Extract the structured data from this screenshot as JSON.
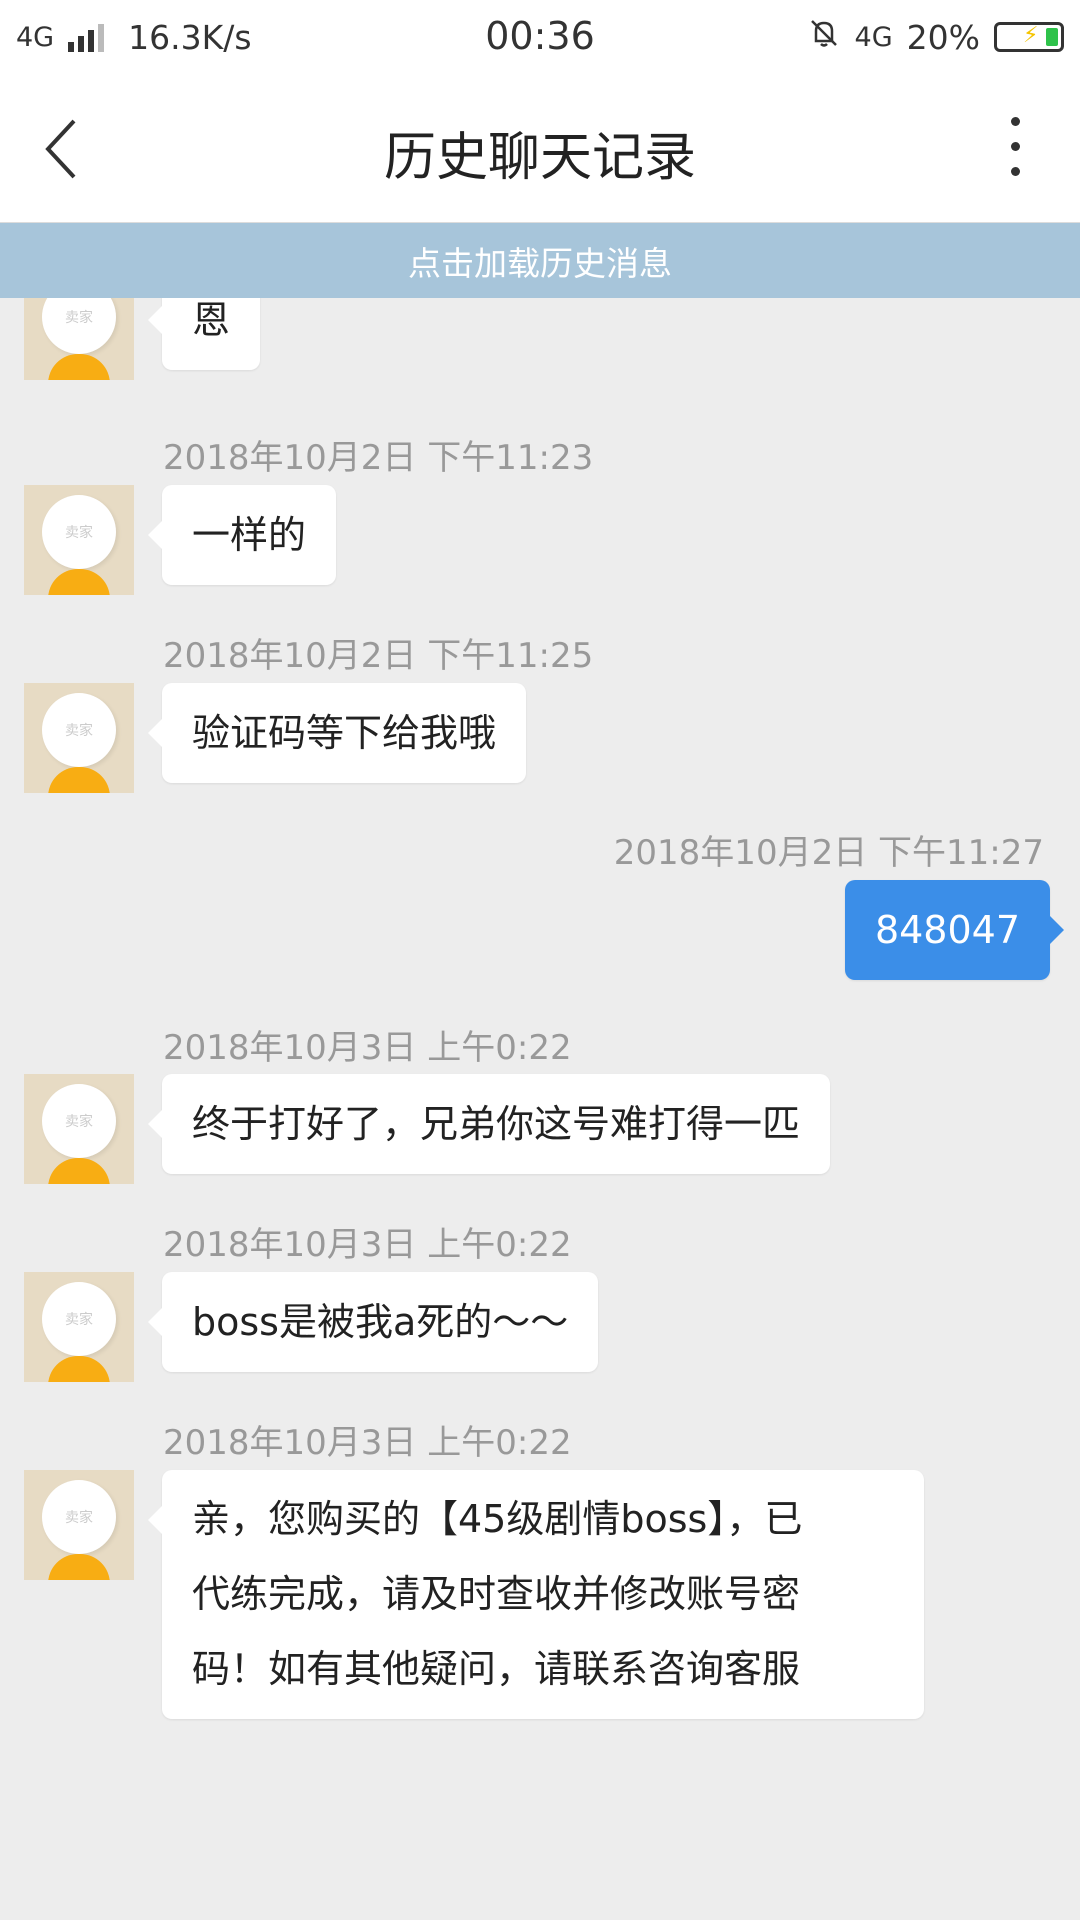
{
  "status_bar": {
    "network": "4G",
    "speed": "16.3K/s",
    "time": "00:36",
    "network_right": "4G",
    "battery": "20%",
    "battery_level_percent": 20
  },
  "nav": {
    "title": "历史聊天记录",
    "back_icon": "chevron-left-icon",
    "more_icon": "more-vertical-icon"
  },
  "load_history_label": "点击加载历史消息",
  "avatar_label": "卖家",
  "messages": [
    {
      "timestamp": "",
      "text": "恩",
      "sender": "seller"
    },
    {
      "timestamp": "2018年10月2日 下午11:23",
      "text": "一样的",
      "sender": "seller"
    },
    {
      "timestamp": "2018年10月2日 下午11:25",
      "text": "验证码等下给我哦",
      "sender": "seller"
    },
    {
      "timestamp": "2018年10月2日 下午11:27",
      "text": "848047",
      "sender": "me"
    },
    {
      "timestamp": "2018年10月3日 上午0:22",
      "text": "终于打好了，兄弟你这号难打得一匹",
      "sender": "seller"
    },
    {
      "timestamp": "2018年10月3日 上午0:22",
      "text": "boss是被我a死的～～",
      "sender": "seller"
    },
    {
      "timestamp": "2018年10月3日 上午0:22",
      "lines": [
        "亲，您购买的【45级剧情boss】，已",
        "代练完成，请及时查收并修改账号密",
        "码！如有其他疑问，请联系咨询客服"
      ],
      "sender": "seller"
    }
  ],
  "colors": {
    "background": "#ededed",
    "load_bar": "#a7c5da",
    "my_bubble": "#3b8ee8",
    "avatar_bg": "#e7dbc4",
    "avatar_body": "#f8ad13"
  }
}
